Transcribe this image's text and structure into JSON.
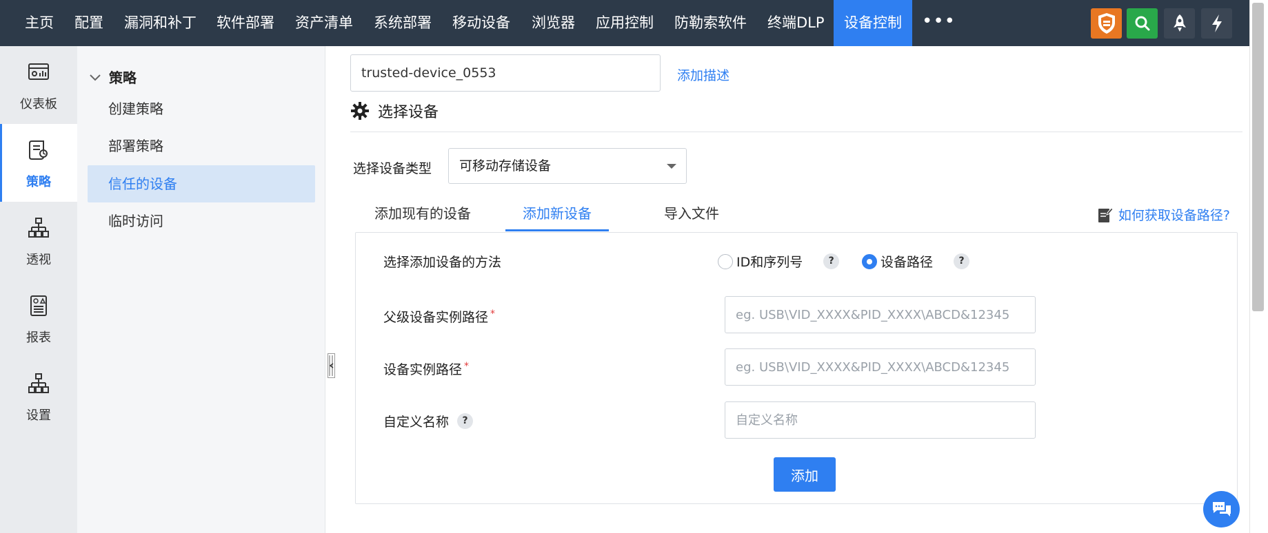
{
  "topnav": {
    "items": [
      "主页",
      "配置",
      "漏洞和补丁",
      "软件部署",
      "资产清单",
      "系统部署",
      "移动设备",
      "浏览器",
      "应用控制",
      "防勒索软件",
      "终端DLP",
      "设备控制"
    ],
    "active_index": 11,
    "more_label": "•••",
    "tools": [
      "shield-icon",
      "search-icon",
      "rocket-icon",
      "bolt-icon"
    ],
    "tool_colors": [
      "#e87722",
      "#29a84a",
      "#3b4654",
      "#3b4654"
    ]
  },
  "rail": {
    "items": [
      {
        "label": "仪表板",
        "icon": "dashboard-icon"
      },
      {
        "label": "策略",
        "icon": "policy-icon"
      },
      {
        "label": "透视",
        "icon": "insight-icon"
      },
      {
        "label": "报表",
        "icon": "report-icon"
      },
      {
        "label": "设置",
        "icon": "settings-icon"
      }
    ],
    "active_index": 1
  },
  "submenu": {
    "heading": "策略",
    "items": [
      "创建策略",
      "部署策略",
      "信任的设备",
      "临时访问"
    ],
    "active_index": 2
  },
  "main": {
    "name_value": "trusted-device_0553",
    "add_description": "添加描述",
    "section_title": "选择设备",
    "device_type_label": "选择设备类型",
    "device_type_value": "可移动存储设备",
    "tabs": [
      "添加现有的设备",
      "添加新设备",
      "导入文件"
    ],
    "active_tab": 1,
    "help_link": "如何获取设备路径?",
    "form": {
      "method_label": "选择添加设备的方法",
      "method_options": [
        "ID和序列号",
        "设备路径"
      ],
      "method_selected": 1,
      "parent_path_label": "父级设备实例路径",
      "parent_path_placeholder": "eg. USB\\VID_XXXX&PID_XXXX\\ABCD&12345",
      "path_label": "设备实例路径",
      "path_placeholder": "eg. USB\\VID_XXXX&PID_XXXX\\ABCD&12345",
      "custom_name_label": "自定义名称",
      "custom_name_placeholder": "自定义名称",
      "required_mark": "*",
      "help_mark": "?",
      "add_button": "添加"
    }
  },
  "colors": {
    "accent": "#2f7ff1",
    "nav_bg": "#2d3a49",
    "required": "#e23b3b"
  }
}
